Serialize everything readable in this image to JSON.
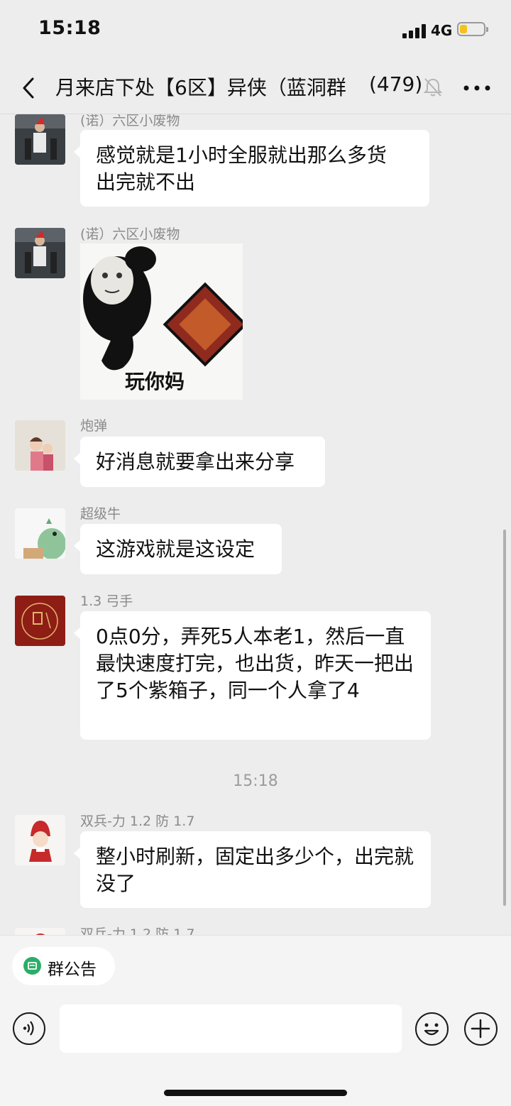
{
  "status_bar": {
    "time": "15:18",
    "network": "4G",
    "battery_level": 0.25,
    "signal_bars": 4
  },
  "header": {
    "title": "月来店下处【6区】异侠（蓝洞群",
    "member_count": "(479)",
    "back_icon": "chevron-left-icon",
    "mute_icon": "bell-slash-icon",
    "more_icon": "ellipsis-icon"
  },
  "messages": [
    {
      "sender": "(诺）六区小废物",
      "text": "感觉就是1小时全服就出那么多货\n出完就不出",
      "type": "text"
    },
    {
      "sender": "(诺）六区小废物",
      "type": "sticker",
      "sticker_caption": "玩你妈"
    },
    {
      "sender": "炮弹",
      "text": "好消息就要拿出来分享",
      "type": "text"
    },
    {
      "sender": "超级牛",
      "text": "这游戏就是这设定",
      "type": "text"
    },
    {
      "sender": "1.3 弓手",
      "text": "0点0分，弄死5人本老1，然后一直最快速度打完，也出货，昨天一把出了5个紫箱子，同一个人拿了4",
      "type": "text"
    },
    {
      "sender": "双兵-力 1.2 防 1.7",
      "text": "整小时刷新，固定出多少个，出完就没了",
      "type": "text"
    },
    {
      "sender": "双兵-力 1.2 防 1.7",
      "type": "partial"
    }
  ],
  "timestamp": "15:18",
  "notice": {
    "label": "群公告",
    "icon": "notice-icon"
  },
  "input": {
    "value": "",
    "voice_icon": "voice-icon",
    "emoji_icon": "emoji-icon",
    "plus_icon": "plus-icon"
  },
  "colors": {
    "background": "#ededed",
    "bubble": "#ffffff",
    "accent": "#2aae67",
    "battery": "#f4c11d"
  }
}
